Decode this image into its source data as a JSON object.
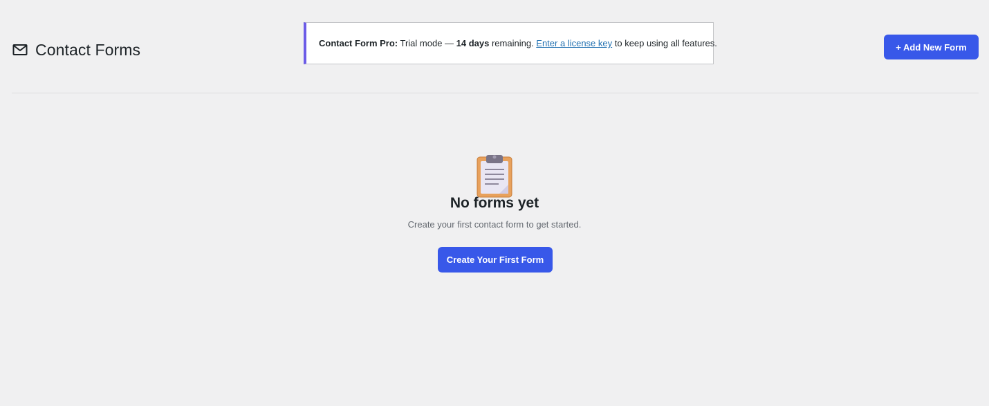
{
  "header": {
    "title": "Contact Forms",
    "icon": "mail-icon",
    "add_button_label": "+ Add New Form"
  },
  "notice": {
    "product": "Contact Form Pro:",
    "text_before": " Trial mode — ",
    "days": "14 days",
    "text_middle": " remaining. ",
    "link_label": "Enter a license key",
    "text_after": " to keep using all features.",
    "accent_color": "#6c5ce7"
  },
  "empty_state": {
    "icon": "clipboard-icon",
    "title": "No forms yet",
    "subtitle": "Create your first contact form to get started.",
    "button_label": "Create Your First Form"
  },
  "colors": {
    "primary": "#3858e9",
    "background": "#f0f0f1",
    "link": "#2271b1"
  }
}
